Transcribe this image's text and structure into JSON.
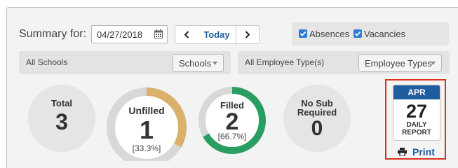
{
  "summary": {
    "label": "Summary for:",
    "date_value": "04/27/2018",
    "calendar_icon": "calendar-icon",
    "prev_icon": "chevron-left-icon",
    "today_label": "Today",
    "next_icon": "chevron-right-icon"
  },
  "toggles": [
    {
      "label": "Absences",
      "checked": true
    },
    {
      "label": "Vacancies",
      "checked": true
    }
  ],
  "filters": {
    "schools_text": "All Schools",
    "schools_select": "Schools",
    "employee_text": "All Employee Type(s)",
    "employee_select": "Employee Types"
  },
  "stats": {
    "total": {
      "title": "Total",
      "value": "3"
    },
    "unfilled": {
      "title": "Unfilled",
      "value": "1",
      "percent": "[33.3%]",
      "fraction": 0.333,
      "color": "#dbb06a"
    },
    "filled": {
      "title": "Filled",
      "value": "2",
      "percent": "[66.7%]",
      "fraction": 0.667,
      "color": "#2a9d62"
    },
    "no_sub": {
      "title_line1": "No Sub",
      "title_line2": "Required",
      "value": "0"
    }
  },
  "daily_report": {
    "month": "APR",
    "day": "27",
    "line1": "DAILY",
    "line2": "REPORT",
    "print_label": "Print",
    "print_icon": "printer-icon"
  },
  "colors": {
    "accent": "#1f5da0",
    "checkbox": "#2e7dd1",
    "highlight_border": "#d9331f"
  }
}
